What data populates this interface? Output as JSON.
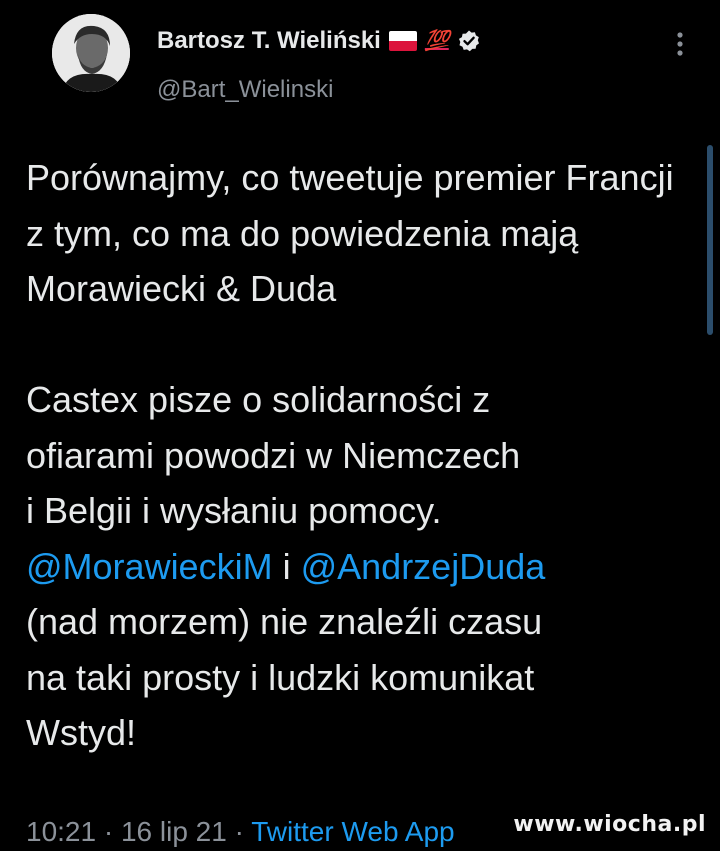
{
  "author": {
    "display_name": "Bartosz T. Wieliński",
    "badge_emoji": "💯",
    "handle": "@Bart_Wielinski",
    "icons": [
      "poland-flag-icon",
      "hundred-points-icon",
      "verified-badge-icon"
    ]
  },
  "tweet": {
    "paragraph1": "Porównajmy, co tweetuje premier Francji z tym, co ma do powiedzenia mają Morawiecki & Duda",
    "p2_line1": "Castex pisze o solidarności z",
    "p2_line2": "ofiarami powodzi w Niemczech",
    "p2_line3": "i Belgii i wysłaniu pomocy.",
    "mention1": "@MorawieckiM",
    "conj": " i ",
    "mention2": "@AndrzejDuda",
    "p2_rest1": "(nad morzem) nie znaleźli czasu",
    "p2_rest2": "na taki prosty i ludzki komunikat",
    "closing": "Wstyd!"
  },
  "meta": {
    "time": "10:21",
    "sep1": " · ",
    "date": "16 lip 21",
    "sep2": " · ",
    "source": "Twitter Web App"
  },
  "watermark": "www.wiocha.pl",
  "colors": {
    "background": "#000000",
    "text": "#e7e9ea",
    "secondary": "#8b9199",
    "link": "#1d9bf0"
  }
}
